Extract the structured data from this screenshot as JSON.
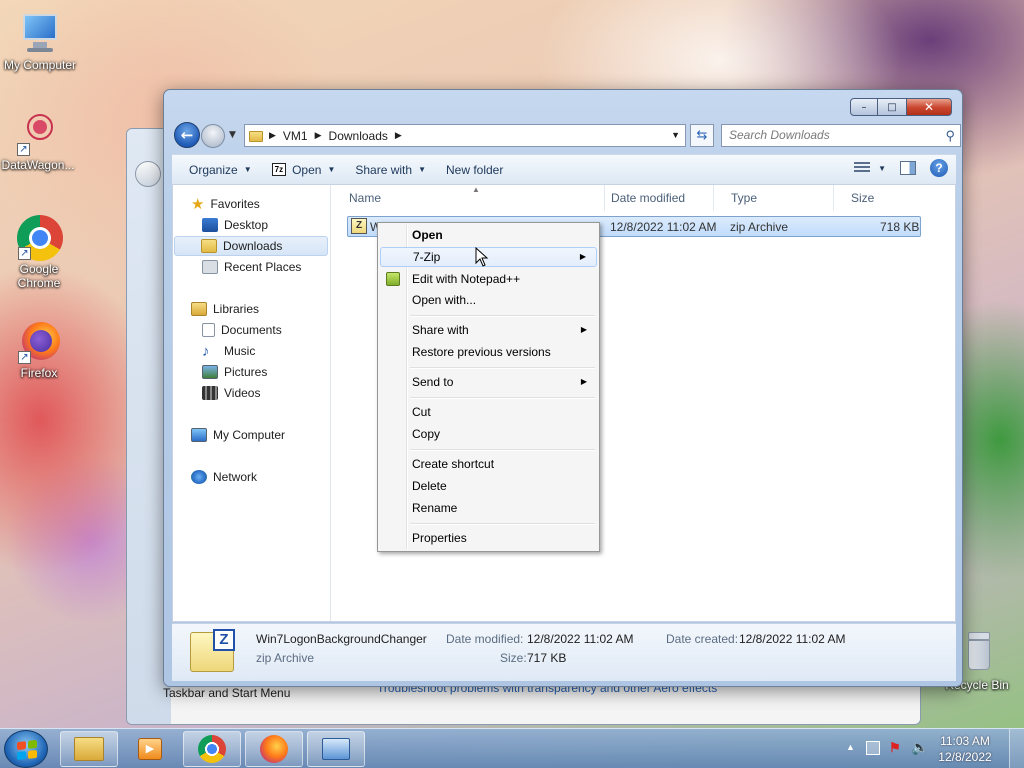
{
  "desktop": {
    "icons": [
      {
        "label": "My Computer"
      },
      {
        "label": "DataWagon..."
      },
      {
        "label": "Google Chrome"
      },
      {
        "label": "Firefox"
      },
      {
        "label": "Recycle Bin"
      }
    ],
    "background_window": {
      "taskbar_link": "Taskbar and Start Menu",
      "troubleshoot_link": "Troubleshoot problems with transparency and other Aero effects"
    }
  },
  "explorer": {
    "caption": {
      "minimize": "–",
      "maximize": "□",
      "close": "✕"
    },
    "address": {
      "seg1": "VM1",
      "seg2": "Downloads"
    },
    "search_placeholder": "Search Downloads",
    "toolbar": {
      "organize": "Organize",
      "open": "Open",
      "open_badge": "7z",
      "share_with": "Share with",
      "new_folder": "New folder"
    },
    "navpane": {
      "favorites": "Favorites",
      "desktop": "Desktop",
      "downloads": "Downloads",
      "recent_places": "Recent Places",
      "libraries": "Libraries",
      "documents": "Documents",
      "music": "Music",
      "pictures": "Pictures",
      "videos": "Videos",
      "my_computer": "My Computer",
      "network": "Network"
    },
    "columns": {
      "name": "Name",
      "date_modified": "Date modified",
      "type": "Type",
      "size": "Size"
    },
    "file": {
      "name_visible": "W",
      "date_modified": "12/8/2022 11:02 AM",
      "type": "zip Archive",
      "size": "718 KB"
    },
    "details": {
      "filename": "Win7LogonBackgroundChanger",
      "type": "zip Archive",
      "date_modified_label": "Date modified:",
      "date_modified_value": "12/8/2022 11:02 AM",
      "date_created_label": "Date created:",
      "date_created_value": "12/8/2022 11:02 AM",
      "size_label": "Size:",
      "size_value": "717 KB"
    }
  },
  "context_menu": {
    "open": "Open",
    "seven_zip": "7-Zip",
    "edit_notepad": "Edit with Notepad++",
    "open_with": "Open with...",
    "share_with": "Share with",
    "restore": "Restore previous versions",
    "send_to": "Send to",
    "cut": "Cut",
    "copy": "Copy",
    "create_shortcut": "Create shortcut",
    "delete": "Delete",
    "rename": "Rename",
    "properties": "Properties"
  },
  "taskbar": {
    "time": "11:03 AM",
    "date": "12/8/2022"
  },
  "colors": {
    "accent": "#1f5bb8",
    "selection": "#c1dcfc",
    "close_button": "#c9452d"
  }
}
